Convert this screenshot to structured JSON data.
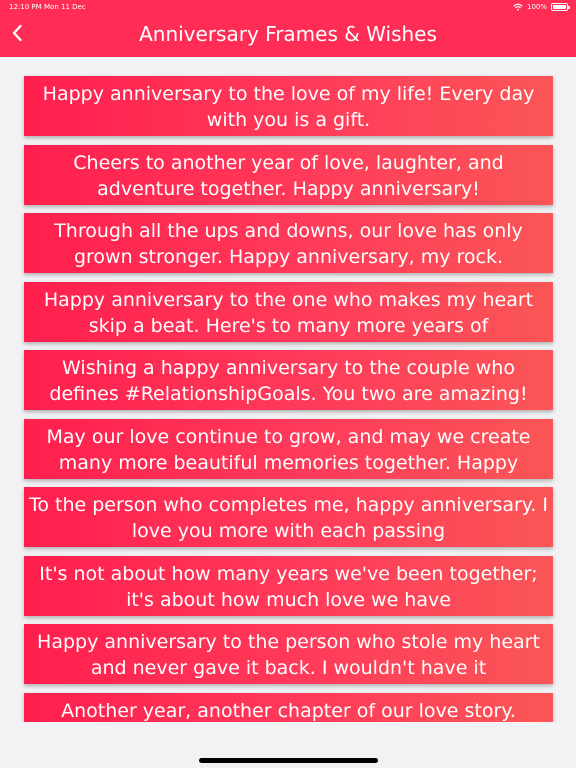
{
  "status_bar": {
    "time": "12:10 PM",
    "date": "Mon 11 Dec",
    "battery": "100%"
  },
  "header": {
    "title": "Anniversary Frames & Wishes",
    "back_icon": "chevron-left-icon"
  },
  "wishes": [
    {
      "text": "Happy anniversary to the love of my life! Every day with you is a gift."
    },
    {
      "text": "Cheers to another year of love, laughter, and adventure together. Happy anniversary!"
    },
    {
      "text": "Through all the ups and downs, our love has only grown stronger. Happy anniversary, my rock."
    },
    {
      "text": "Happy anniversary to the one who makes my heart skip a beat. Here's to many more years of"
    },
    {
      "text": "Wishing a happy anniversary to the couple who defines #RelationshipGoals. You two are amazing!"
    },
    {
      "text": "May our love continue to grow, and may we create many more beautiful memories together. Happy"
    },
    {
      "text": "To the person who completes me, happy anniversary. I love you more with each passing"
    },
    {
      "text": "It's not about how many years we've been together; it's about how much love we have"
    },
    {
      "text": "Happy anniversary to the person who stole my heart and never gave it back. I wouldn't have it"
    },
    {
      "text": "Another year, another chapter of our love story."
    }
  ],
  "colors": {
    "accent": "#ff2d55",
    "card_start": "#ff1f4e",
    "card_end": "#fa5656",
    "background": "#f2f2f4"
  }
}
